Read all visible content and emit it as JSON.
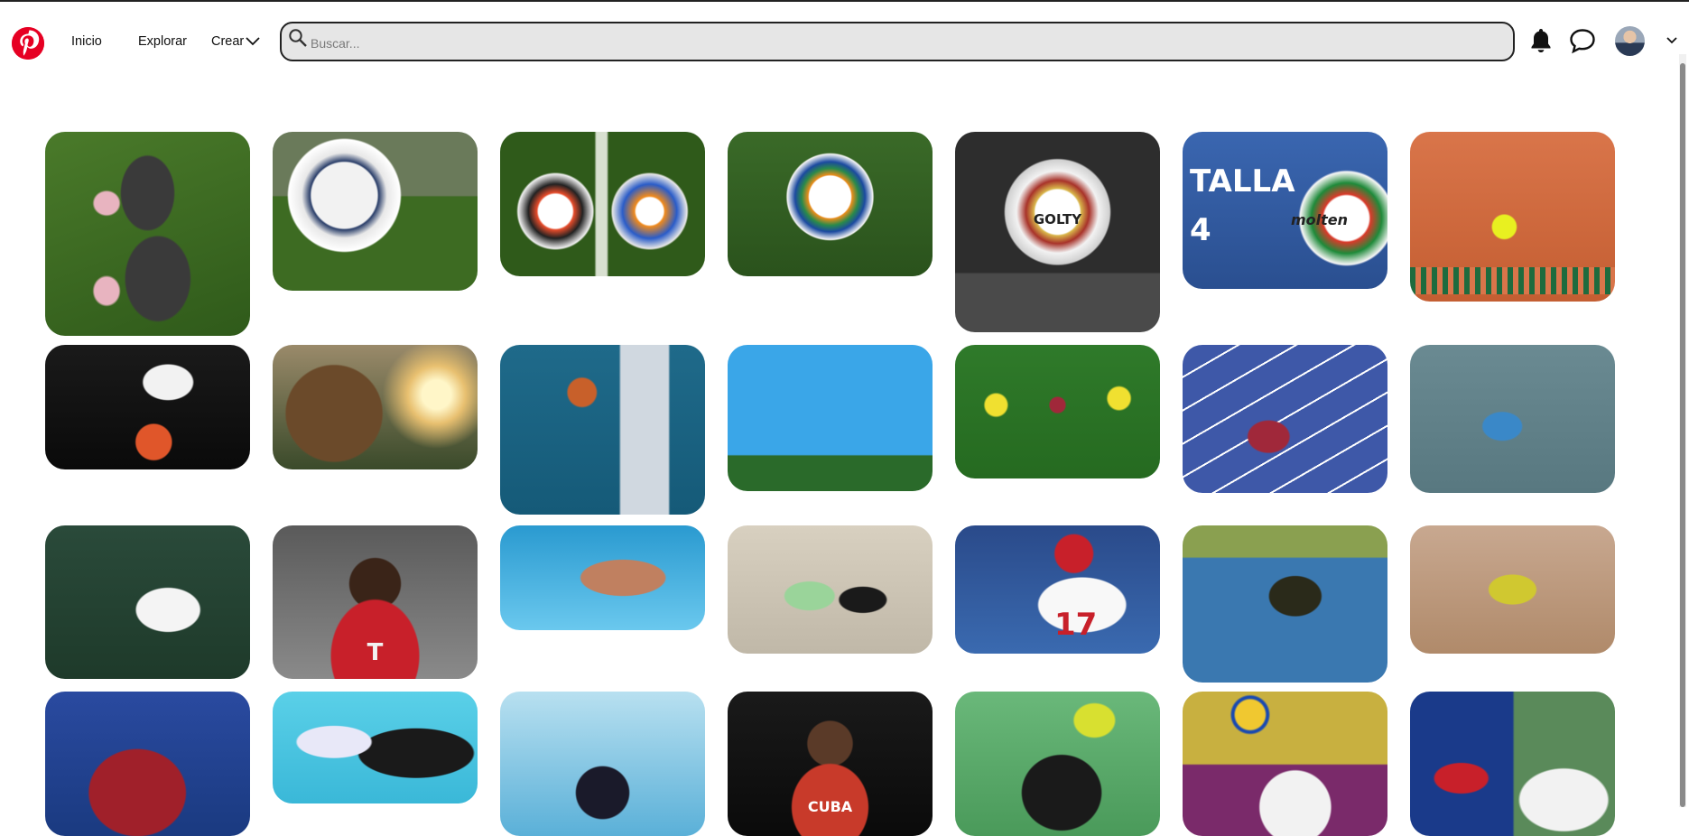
{
  "app": {
    "brand_color": "#e60023"
  },
  "header": {
    "logo_icon": "pinterest-logo-icon",
    "nav": {
      "home": "Inicio",
      "explore": "Explorar",
      "create": "Crear"
    },
    "search": {
      "placeholder": "Buscar..."
    },
    "icons": [
      "bell-icon",
      "chat-bubble-icon",
      "avatar",
      "chevron-down-icon"
    ]
  },
  "pins": [
    {
      "id": "soccer-cleats",
      "label": ""
    },
    {
      "id": "soccer-ball-grass",
      "label": ""
    },
    {
      "id": "two-soccer-balls",
      "label": ""
    },
    {
      "id": "brazuca-ball",
      "label": ""
    },
    {
      "id": "golty-ball",
      "label": "GOLTY"
    },
    {
      "id": "volleyball-talla",
      "label": "TALLA 4",
      "sublabel": "molten"
    },
    {
      "id": "tennis-ball-net",
      "label": ""
    },
    {
      "id": "basketball-hoop-dark",
      "label": ""
    },
    {
      "id": "basketball-sunset",
      "label": ""
    },
    {
      "id": "basketball-backboard",
      "label": ""
    },
    {
      "id": "long-jumper-sky",
      "label": ""
    },
    {
      "id": "soccer-match",
      "label": ""
    },
    {
      "id": "sprinter-track",
      "label": ""
    },
    {
      "id": "tennis-player",
      "label": ""
    },
    {
      "id": "nadal-wimbledon",
      "label": ""
    },
    {
      "id": "bayern-player",
      "label": "T"
    },
    {
      "id": "swimmer-butterfly",
      "label": ""
    },
    {
      "id": "tennis-players-net",
      "label": ""
    },
    {
      "id": "baseball-player",
      "label": "17"
    },
    {
      "id": "jamaica-sprinter",
      "label": ""
    },
    {
      "id": "long-jump-sand",
      "label": ""
    },
    {
      "id": "phelps-medal",
      "label": ""
    },
    {
      "id": "lebron-shoe",
      "label": ""
    },
    {
      "id": "swimmer-pool",
      "label": ""
    },
    {
      "id": "cuba-wrestler",
      "label": "CUBA"
    },
    {
      "id": "serena-racket",
      "label": ""
    },
    {
      "id": "volleyball-player",
      "label": ""
    },
    {
      "id": "cyclists",
      "label": ""
    }
  ]
}
